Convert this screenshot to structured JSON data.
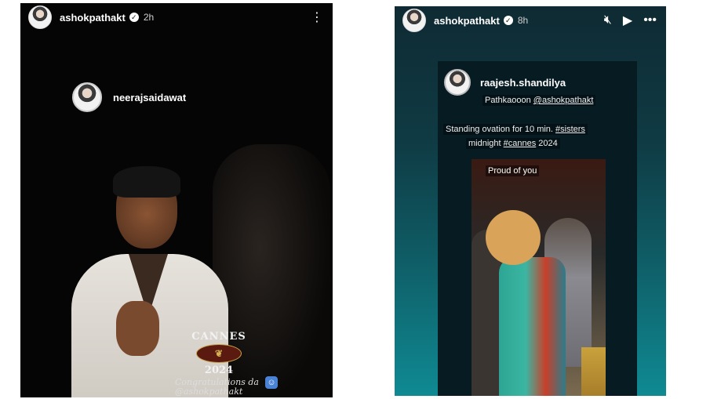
{
  "left_story": {
    "username": "ashokpathakt",
    "verified_mark": "✓",
    "time": "2h",
    "menu_icon": "more-vertical-icon",
    "mentioned_user": "neerajsaidawat",
    "cannes_title": "CANNES",
    "cannes_year": "2024",
    "congrats_line1": "Congratulations da",
    "congrats_line2": "@ashokpathakt",
    "emoji": "hug-emoji-icon"
  },
  "right_story": {
    "username": "ashokpathakt",
    "verified_mark": "✓",
    "time": "8h",
    "icons": [
      "mute-icon",
      "play-icon",
      "more-horizontal-icon"
    ],
    "repost_username": "raajesh.shandilya",
    "caption1_prefix": "Pathkaooon ",
    "caption1_mention": "@ashokpathakt",
    "caption2_text": "Standing ovation for 10 min. ",
    "caption2_tag": "#sisters",
    "caption3_text": "midnight ",
    "caption3_tag": "#cannes",
    "caption3_suffix": " 2024",
    "video_label": "Proud of you"
  }
}
